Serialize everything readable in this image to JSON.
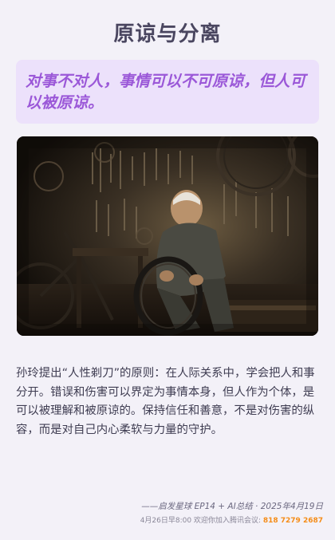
{
  "page": {
    "title": "原谅与分离",
    "quote": "对事不对人，事情可以不可原谅，但人可以被原谅。",
    "image_alt": "老人在昏暗的修车铺里修理自行车轮胎",
    "body": "孙玲提出“人性剃刀”的原则：在人际关系中，学会把人和事分开。错误和伤害可以界定为事情本身，但人作为个体，是可以被理解和被原谅的。保持信任和善意，不是对伤害的纵容，而是对自己内心柔软与力量的守护。"
  },
  "footer": {
    "credit": "——启发星球 EP14 + AI总结 · 2025年4月19日",
    "meeting_prefix": "4月26日早8:00 欢迎你加入腾讯会议: ",
    "meeting_number": "818 7279 2687"
  },
  "colors": {
    "background": "#f3f1f8",
    "title": "#4a4660",
    "quote_bg": "#ece1fb",
    "quote_text": "#9b58d8",
    "body_text": "#3f3d52",
    "meeting_accent": "#f58c17"
  }
}
